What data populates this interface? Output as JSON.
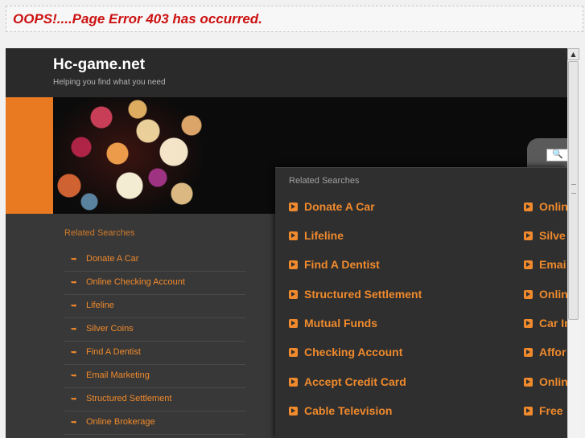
{
  "error_message": "OOPS!....Page Error 403 has occurred.",
  "site": {
    "title": "Hc-game.net",
    "tagline": "Helping you find what you need"
  },
  "search_icon": "search-icon",
  "sidebar": {
    "heading": "Related Searches",
    "items": [
      "Donate A Car",
      "Online Checking Account",
      "Lifeline",
      "Silver Coins",
      "Find A Dentist",
      "Email Marketing",
      "Structured Settlement",
      "Online Brokerage"
    ]
  },
  "panel": {
    "heading": "Related Searches",
    "left_items": [
      "Donate A Car",
      "Lifeline",
      "Find A Dentist",
      "Structured Settlement",
      "Mutual Funds",
      "Checking Account",
      "Accept Credit Card",
      "Cable Television"
    ],
    "right_items": [
      "Onlin",
      "Silve",
      "Emai",
      "Onlin",
      "Car In",
      "Affor",
      "Onlin",
      "Free"
    ]
  },
  "colors": {
    "accent": "#f08a2c",
    "error": "#cc1111",
    "background": "#262626"
  }
}
